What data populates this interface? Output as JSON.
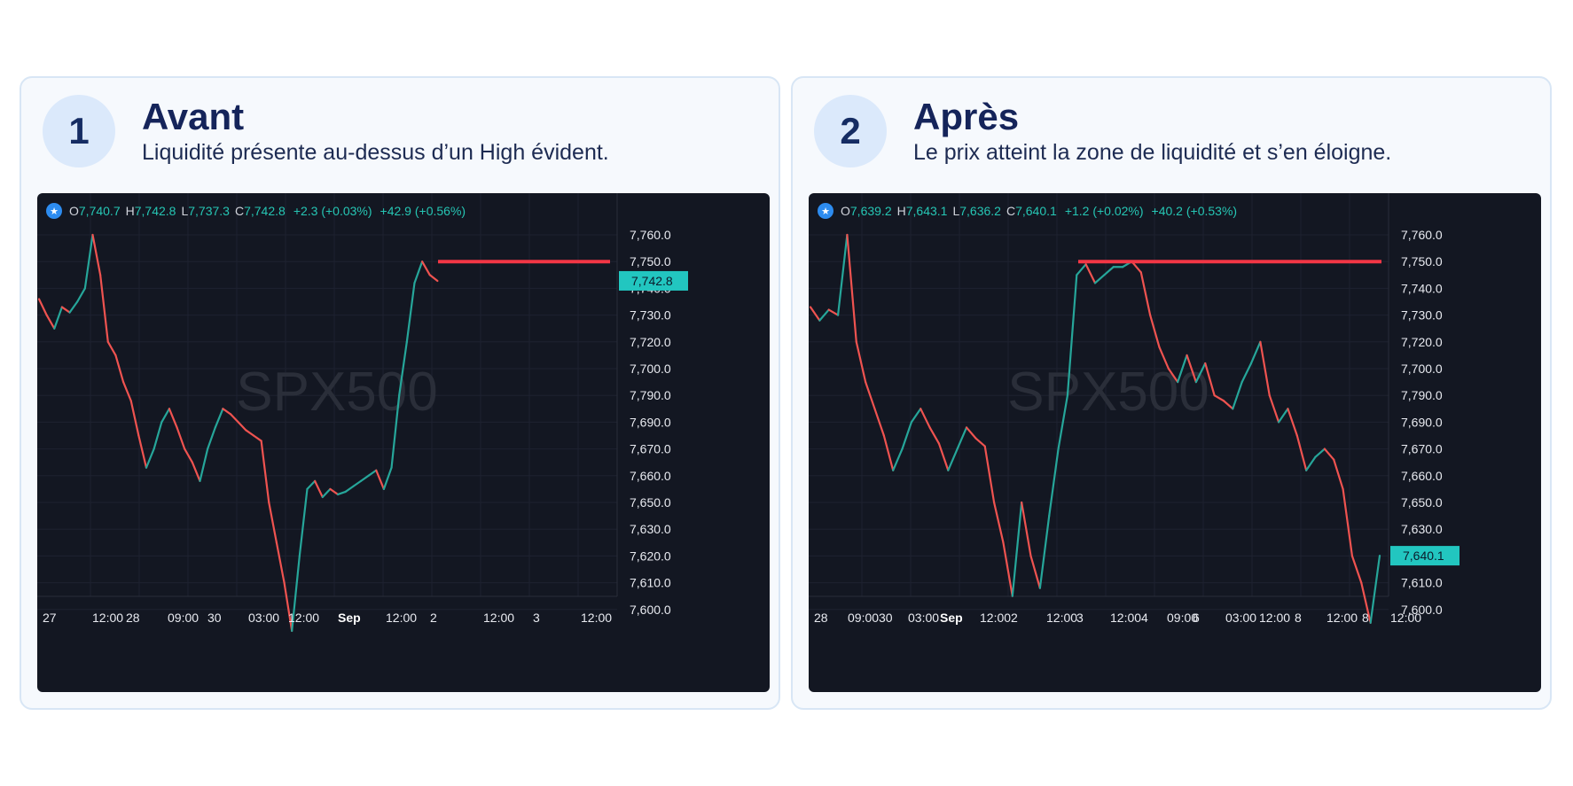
{
  "panels": [
    {
      "badge": "1",
      "title": "Avant",
      "subtitle": "Liquidité présente au-dessus d’un High évident.",
      "legend": {
        "o_label": "O",
        "o": "7,740.7",
        "h_label": "H",
        "h": "7,742.8",
        "l_label": "L",
        "l": "7,737.3",
        "c_label": "C",
        "c": "7,742.8",
        "change": "+2.3 (+0.03%)",
        "change2": "+42.9 (+0.56%)"
      }
    },
    {
      "badge": "2",
      "title": "Après",
      "subtitle": "Le prix atteint la zone de liquidité et s’en éloigne.",
      "legend": {
        "o_label": "O",
        "o": "7,639.2",
        "h_label": "H",
        "h": "7,643.1",
        "l_label": "L",
        "l": "7,636.2",
        "c_label": "C",
        "c": "7,640.1",
        "change": "+1.2 (+0.02%)",
        "change2": "+40.2 (+0.53%)"
      }
    }
  ],
  "chart_data": [
    {
      "type": "line",
      "watermark": "SPX500",
      "y_ticks": [
        "7,760.0",
        "7,750.0",
        "7,740.0",
        "7,730.0",
        "7,720.0",
        "7,700.0",
        "7,790.0",
        "7,690.0",
        "7,670.0",
        "7,660.0",
        "7,650.0",
        "7,630.0",
        "7,620.0",
        "7,610.0",
        "7,600.0"
      ],
      "x_ticks": [
        "27",
        "12:00",
        "28",
        "09:00",
        "30",
        "03:00",
        "12:00",
        "Sep",
        "12:00",
        "2",
        "12:00",
        "3",
        "12:00"
      ],
      "last_price": "7,742.8",
      "level_line": {
        "value": 7750,
        "color": "#f23645"
      },
      "colors": {
        "up": "#26a69a",
        "down": "#ef5350",
        "level": "#f23645",
        "price_tag": "#22c6c0"
      },
      "series": [
        {
          "y": [
            7736,
            7730,
            7725,
            7733,
            7731,
            7735,
            7740,
            7760,
            7745,
            7720,
            7715,
            7705,
            7698,
            7685,
            7673,
            7680,
            7690,
            7695,
            7688,
            7680,
            7675,
            7668,
            7680,
            7688,
            7695,
            7693,
            7690,
            7687,
            7685,
            7683,
            7660,
            7645,
            7630,
            7612,
            7640,
            7665,
            7668,
            7662,
            7665,
            7663,
            7664,
            7666,
            7668,
            7670,
            7672,
            7665,
            7673,
            7700,
            7720,
            7742,
            7750,
            7745,
            7742.8
          ]
        }
      ]
    },
    {
      "type": "line",
      "watermark": "SPX500",
      "y_ticks": [
        "7,760.0",
        "7,750.0",
        "7,740.0",
        "7,730.0",
        "7,720.0",
        "7,700.0",
        "7,790.0",
        "7,690.0",
        "7,670.0",
        "7,660.0",
        "7,650.0",
        "7,630.0",
        "7,620.0",
        "7,610.0",
        "7,600.0"
      ],
      "x_ticks": [
        "28",
        "09:00",
        "30",
        "03:00",
        "Sep",
        "12:00",
        "2",
        "12:00",
        "3",
        "12:00",
        "4",
        "09:00",
        "6",
        "03:00",
        "12:00",
        "8",
        "12:00",
        "8",
        "12:00"
      ],
      "last_price": "7,640.1",
      "level_line": {
        "value": 7750,
        "color": "#f23645"
      },
      "colors": {
        "up": "#26a69a",
        "down": "#ef5350",
        "level": "#f23645",
        "price_tag": "#22c6c0"
      },
      "series": [
        {
          "y": [
            7733,
            7728,
            7732,
            7730,
            7760,
            7720,
            7705,
            7695,
            7685,
            7672,
            7680,
            7690,
            7695,
            7688,
            7682,
            7672,
            7680,
            7688,
            7684,
            7681,
            7660,
            7645,
            7625,
            7660,
            7640,
            7628,
            7655,
            7680,
            7700,
            7745,
            7749,
            7742,
            7745,
            7748,
            7748,
            7750,
            7746,
            7730,
            7718,
            7710,
            7705,
            7715,
            7705,
            7712,
            7700,
            7698,
            7695,
            7705,
            7712,
            7720,
            7700,
            7690,
            7695,
            7685,
            7672,
            7677,
            7680,
            7676,
            7665,
            7640,
            7630,
            7615,
            7640.1
          ]
        }
      ]
    }
  ]
}
